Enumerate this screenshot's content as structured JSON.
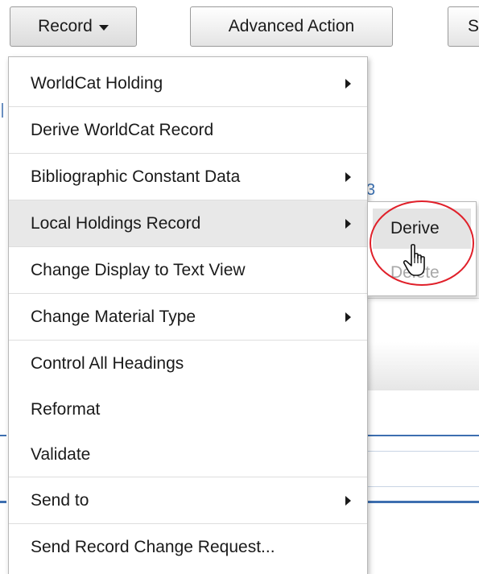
{
  "toolbar": {
    "record_label": "Record",
    "advanced_label": "Advanced Action",
    "third_label": "S"
  },
  "background": {
    "fragment_text": "3"
  },
  "menu": {
    "items": [
      {
        "label": "WorldCat Holding",
        "submenu": true
      },
      {
        "label": "Derive WorldCat Record",
        "submenu": false
      },
      {
        "label": "Bibliographic Constant Data",
        "submenu": true
      },
      {
        "label": "Local Holdings Record",
        "submenu": true
      },
      {
        "label": "Change Display to Text View",
        "submenu": false
      },
      {
        "label": "Change Material Type",
        "submenu": true
      },
      {
        "label": "Control All Headings",
        "submenu": false
      },
      {
        "label": "Reformat",
        "submenu": false
      },
      {
        "label": "Validate",
        "submenu": false
      },
      {
        "label": "Send to",
        "submenu": true
      },
      {
        "label": "Send Record Change Request...",
        "submenu": false
      }
    ],
    "active_index": 3
  },
  "submenu": {
    "derive_label": "Derive",
    "delete_label": "Delete"
  },
  "colors": {
    "highlight_ring": "#e0202a",
    "disabled_text": "#a8a8a8",
    "link_blue": "#3a6fb0"
  },
  "icons": {
    "record_caret": "caret-down-icon",
    "submenu_arrow": "chevron-right-icon",
    "cursor": "hand-pointer-icon"
  }
}
